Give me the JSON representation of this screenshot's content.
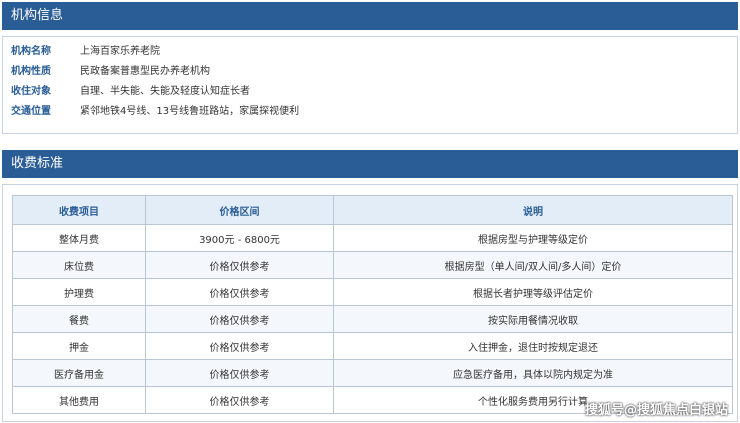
{
  "institution_section": {
    "title": "机构信息",
    "rows": [
      {
        "label": "机构名称",
        "value": "上海百家乐养老院"
      },
      {
        "label": "机构性质",
        "value": "民政备案普惠型民办养老机构"
      },
      {
        "label": "收住对象",
        "value": "自理、半失能、失能及轻度认知症长者"
      },
      {
        "label": "交通位置",
        "value": "紧邻地铁4号线、13号线鲁班路站，家属探视便利"
      }
    ]
  },
  "fee_section": {
    "title": "收费标准",
    "columns": [
      "收费项目",
      "价格区间",
      "说明"
    ],
    "rows": [
      [
        "整体月费",
        "3900元 - 6800元",
        "根据房型与护理等级定价"
      ],
      [
        "床位费",
        "价格仅供参考",
        "根据房型（单人间/双人间/多人间）定价"
      ],
      [
        "护理费",
        "价格仅供参考",
        "根据长者护理等级评估定价"
      ],
      [
        "餐费",
        "价格仅供参考",
        "按实际用餐情况收取"
      ],
      [
        "押金",
        "价格仅供参考",
        "入住押金，退住时按规定退还"
      ],
      [
        "医疗备用金",
        "价格仅供参考",
        "应急医疗备用，具体以院内规定为准"
      ],
      [
        "其他费用",
        "价格仅供参考",
        "个性化服务费用另行计算"
      ]
    ]
  },
  "watermark": "搜狐号@搜狐焦点白银站"
}
